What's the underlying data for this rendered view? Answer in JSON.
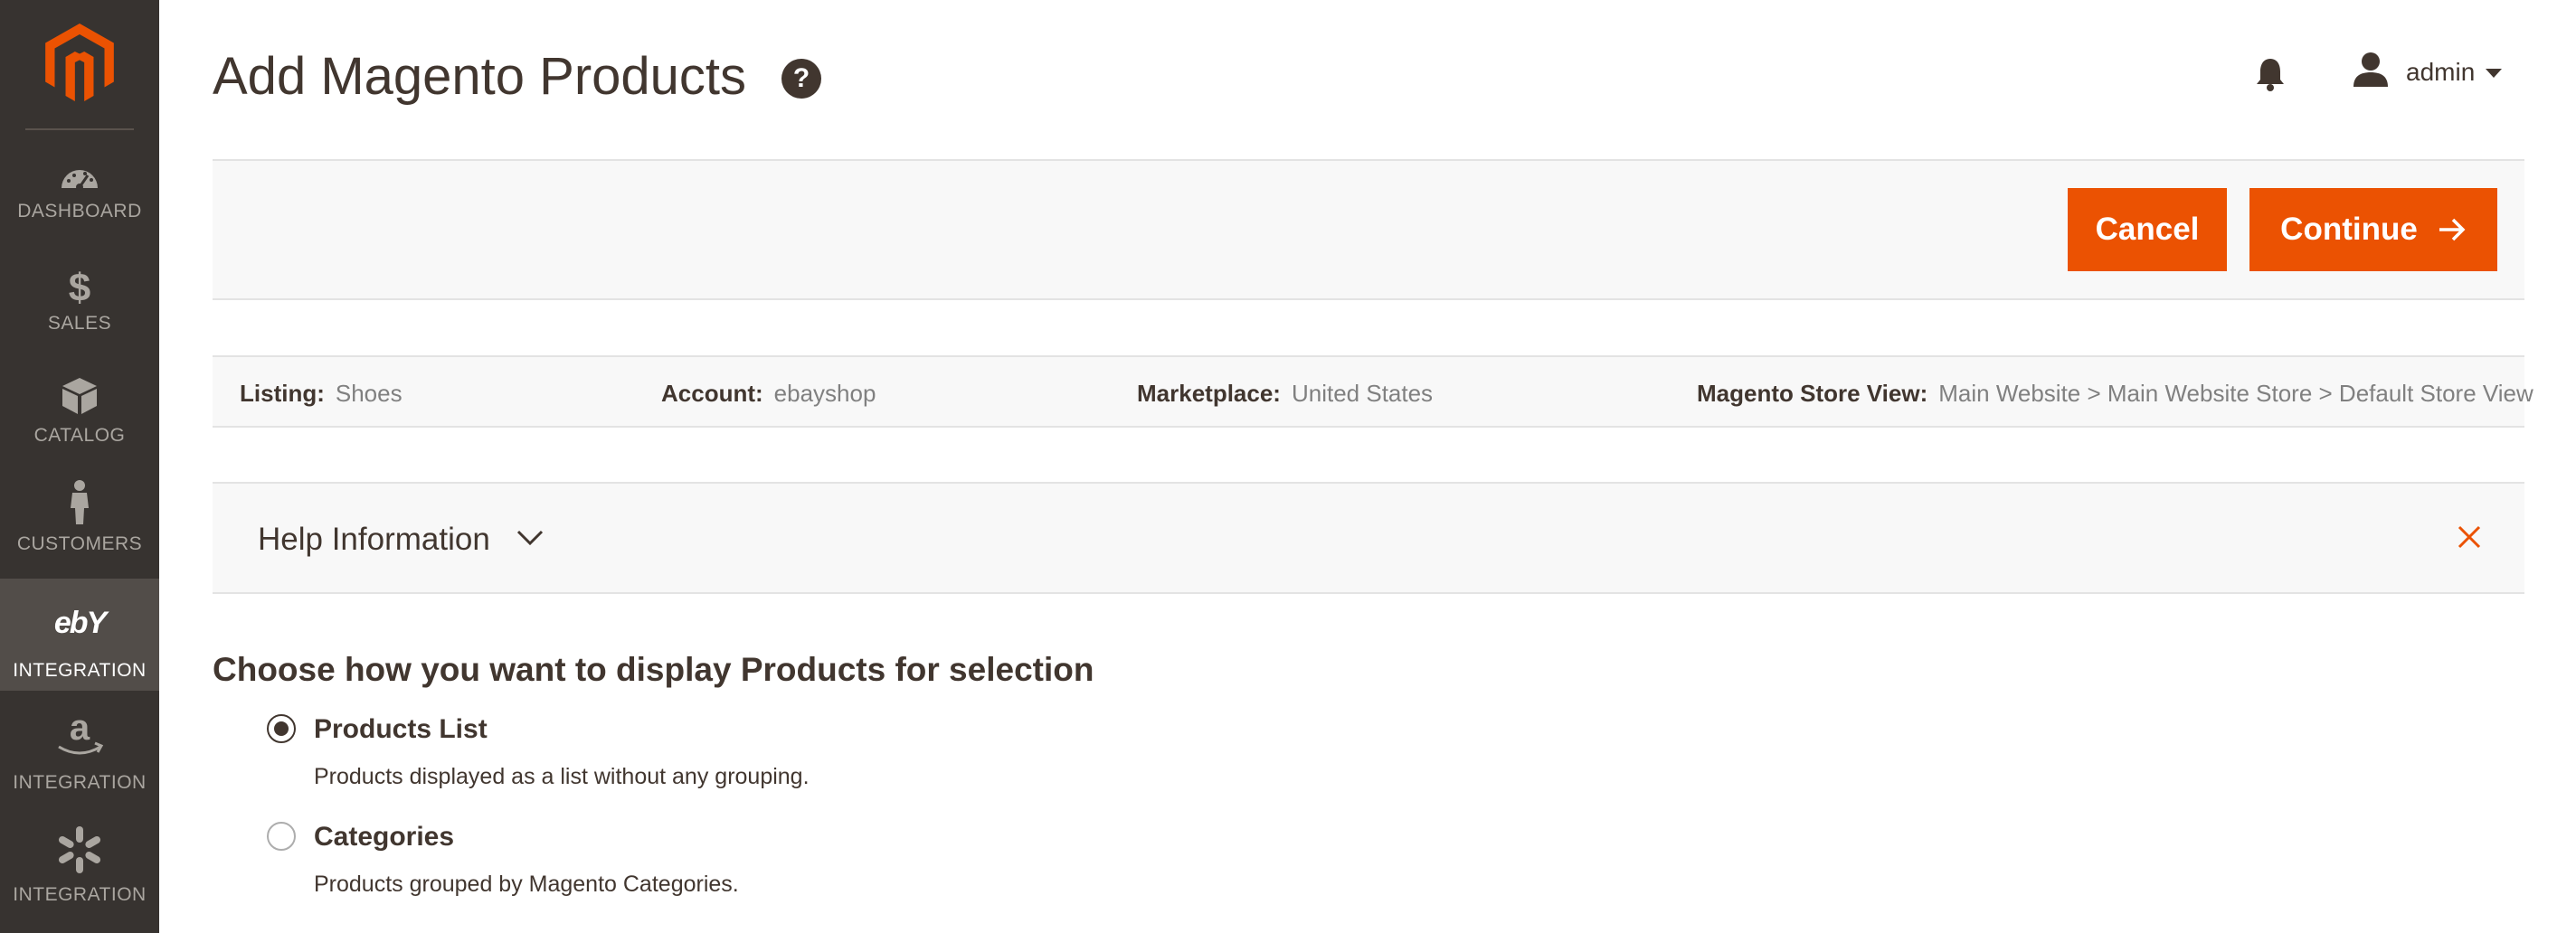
{
  "page": {
    "title": "Add Magento Products",
    "help_icon": "question-icon"
  },
  "header": {
    "user_name": "admin"
  },
  "sidebar": {
    "items": [
      {
        "label": "DASHBOARD",
        "icon": "dashboard-gauge-icon",
        "active": false
      },
      {
        "label": "SALES",
        "icon": "dollar-icon",
        "active": false
      },
      {
        "label": "CATALOG",
        "icon": "box-icon",
        "active": false
      },
      {
        "label": "CUSTOMERS",
        "icon": "person-icon",
        "active": false
      },
      {
        "label": "INTEGRATION",
        "icon": "ebay-logo-icon",
        "active": true
      },
      {
        "label": "INTEGRATION",
        "icon": "amazon-logo-icon",
        "active": false
      },
      {
        "label": "INTEGRATION",
        "icon": "walmart-spark-icon",
        "active": false
      }
    ]
  },
  "actions": {
    "cancel_label": "Cancel",
    "continue_label": "Continue"
  },
  "info": {
    "listing_key": "Listing:",
    "listing_value": "Shoes",
    "account_key": "Account:",
    "account_value": "ebayshop",
    "marketplace_key": "Marketplace:",
    "marketplace_value": "United States",
    "store_view_key": "Magento Store View:",
    "store_view_value": "Main Website > Main Website Store > Default Store View"
  },
  "help_block": {
    "title": "Help Information"
  },
  "choice": {
    "title": "Choose how you want to display Products for selection",
    "options": [
      {
        "label": "Products List",
        "description": "Products displayed as a list without any grouping.",
        "selected": true
      },
      {
        "label": "Categories",
        "description": "Products grouped by Magento Categories.",
        "selected": false
      }
    ]
  },
  "colors": {
    "accent": "#eb5202",
    "sidebar": "#373330",
    "sidebar_active": "#524d49",
    "text": "#41362f"
  }
}
